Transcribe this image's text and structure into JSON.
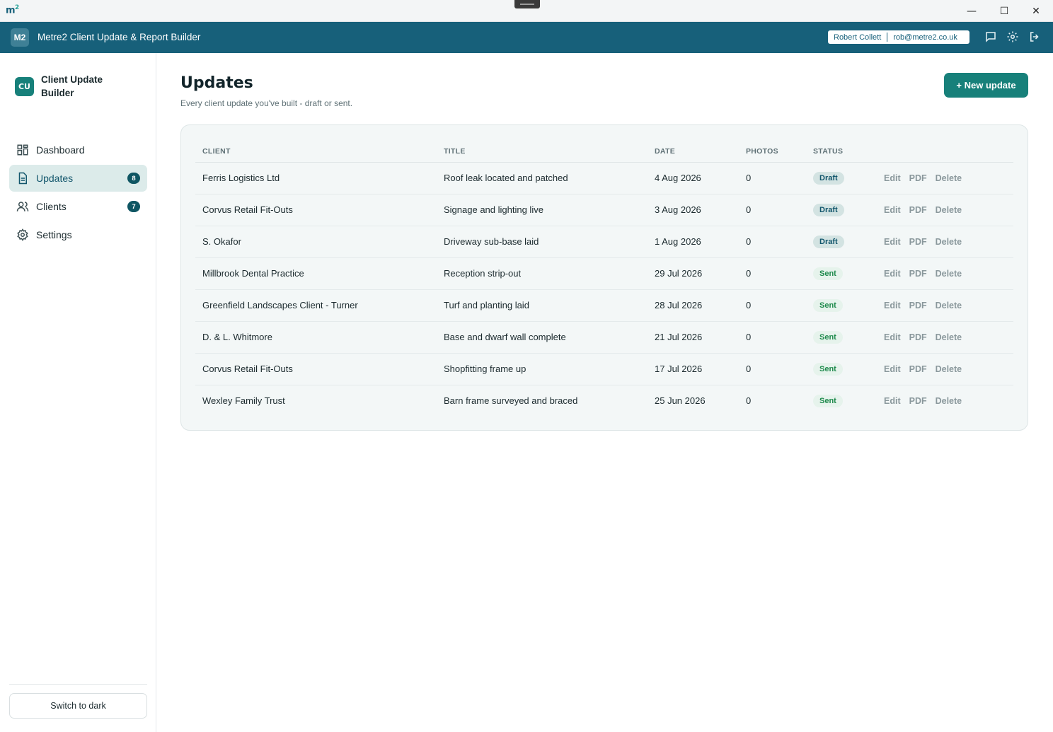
{
  "window": {
    "logo": "m",
    "logo_sup": "2",
    "minimize": "—",
    "maximize": "☐",
    "close": "✕"
  },
  "appbar": {
    "badge": "M2",
    "title": "Metre2 Client Update & Report Builder",
    "user_name": "Robert Collett",
    "user_email": "rob@metre2.co.uk"
  },
  "sidebar": {
    "brand_badge": "CU",
    "brand_name": "Client Update Builder",
    "items": [
      {
        "label": "Dashboard",
        "icon": "grid-icon"
      },
      {
        "label": "Updates",
        "icon": "document-icon",
        "count": "8",
        "active": true
      },
      {
        "label": "Clients",
        "icon": "users-icon",
        "count": "7"
      },
      {
        "label": "Settings",
        "icon": "gear-icon"
      }
    ],
    "theme_toggle": "Switch to dark"
  },
  "page": {
    "title": "Updates",
    "subtitle": "Every client update you've built - draft or sent.",
    "new_button": "+ New update"
  },
  "table": {
    "headers": [
      "CLIENT",
      "TITLE",
      "DATE",
      "PHOTOS",
      "STATUS"
    ],
    "actions": [
      "Edit",
      "PDF",
      "Delete"
    ],
    "rows": [
      {
        "client": "Ferris Logistics Ltd",
        "title": "Roof leak located and patched",
        "date": "4 Aug 2026",
        "photos": "0",
        "status": "Draft"
      },
      {
        "client": "Corvus Retail Fit-Outs",
        "title": "Signage and lighting live",
        "date": "3 Aug 2026",
        "photos": "0",
        "status": "Draft"
      },
      {
        "client": "S. Okafor",
        "title": "Driveway sub-base laid",
        "date": "1 Aug 2026",
        "photos": "0",
        "status": "Draft"
      },
      {
        "client": "Millbrook Dental Practice",
        "title": "Reception strip-out",
        "date": "29 Jul 2026",
        "photos": "0",
        "status": "Sent"
      },
      {
        "client": "Greenfield Landscapes Client - Turner",
        "title": "Turf and planting laid",
        "date": "28 Jul 2026",
        "photos": "0",
        "status": "Sent"
      },
      {
        "client": "D. & L. Whitmore",
        "title": "Base and dwarf wall complete",
        "date": "21 Jul 2026",
        "photos": "0",
        "status": "Sent"
      },
      {
        "client": "Corvus Retail Fit-Outs",
        "title": "Shopfitting frame up",
        "date": "17 Jul 2026",
        "photos": "0",
        "status": "Sent"
      },
      {
        "client": "Wexley Family Trust",
        "title": "Barn frame surveyed and braced",
        "date": "25 Jun 2026",
        "photos": "0",
        "status": "Sent"
      }
    ]
  },
  "colors": {
    "header": "#17607a",
    "accent": "#17807a",
    "draft_bg": "#d3e3e2",
    "sent_text": "#1e8a4c"
  }
}
